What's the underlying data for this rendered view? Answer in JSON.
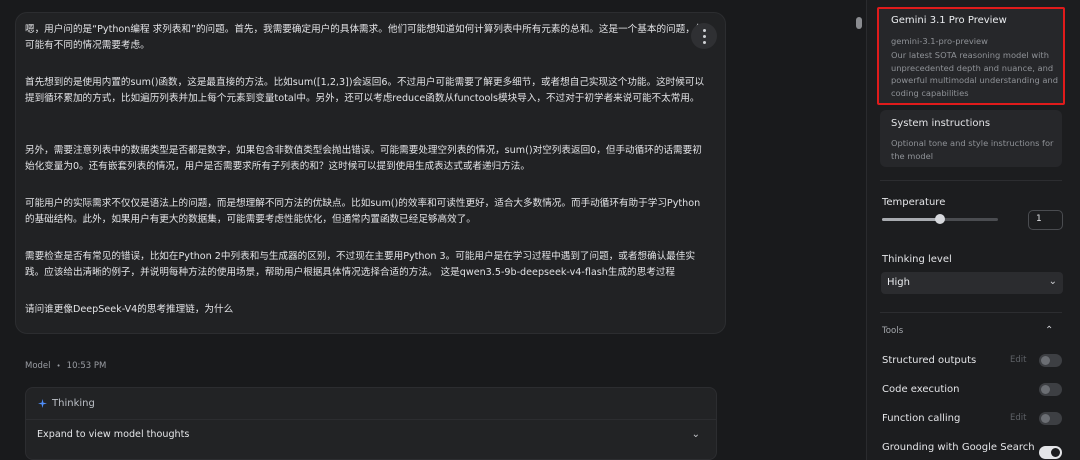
{
  "chat": {
    "paragraphs": [
      "嗯，用户问的是“Python编程 求列表和”的问题。首先，我需要确定用户的具体需求。他们可能想知道如何计算列表中所有元素的总和。这是一个基本的问题，但可能有不同的情况需要考虑。",
      "首先想到的是使用内置的sum()函数，这是最直接的方法。比如sum([1,2,3])会返回6。不过用户可能需要了解更多细节，或者想自己实现这个功能。这时候可以提到循环累加的方式，比如遍历列表并加上每个元素到变量total中。另外，还可以考虑reduce函数从functools模块导入，不过对于初学者来说可能不太常用。",
      "另外，需要注意列表中的数据类型是否都是数字，如果包含非数值类型会抛出错误。可能需要处理空列表的情况，sum()对空列表返回0，但手动循环的话需要初始化变量为0。还有嵌套列表的情况，用户是否需要求所有子列表的和？这时候可以提到使用生成表达式或者递归方法。",
      "可能用户的实际需求不仅仅是语法上的问题，而是想理解不同方法的优缺点。比如sum()的效率和可读性更好，适合大多数情况。而手动循环有助于学习Python的基础结构。此外，如果用户有更大的数据集，可能需要考虑性能优化，但通常内置函数已经足够高效了。",
      "需要检查是否有常见的错误，比如在Python 2中列表和与生成器的区别，不过现在主要用Python 3。可能用户是在学习过程中遇到了问题，或者想确认最佳实践。应该给出清晰的例子，并说明每种方法的使用场景，帮助用户根据具体情况选择合适的方法。 这是qwen3.5-9b-deepseek-v4-flash生成的思考过程",
      "请问谁更像DeepSeek-V4的思考推理链，为什么"
    ],
    "model_label": "Model",
    "timestamp": "10:53 PM",
    "thinking": {
      "label": "Thinking",
      "expand_label": "Expand to view model thoughts"
    }
  },
  "panel": {
    "model": {
      "title": "Gemini 3.1 Pro Preview",
      "id": "gemini-3.1-pro-preview",
      "description": "Our latest SOTA reasoning model with unprecedented depth and nuance, and powerful multimodal understanding and coding capabilities"
    },
    "system": {
      "title": "System instructions",
      "description": "Optional tone and style instructions for the model"
    },
    "temperature": {
      "label": "Temperature",
      "value": "1",
      "fraction": 0.5
    },
    "thinking_level": {
      "label": "Thinking level",
      "value": "High"
    },
    "tools": {
      "label": "Tools",
      "items": [
        {
          "name": "Structured outputs",
          "edit": "Edit",
          "on": false
        },
        {
          "name": "Code execution",
          "edit": "",
          "on": false
        },
        {
          "name": "Function calling",
          "edit": "Edit",
          "on": false
        },
        {
          "name": "Grounding with Google Search",
          "edit": "",
          "on": true
        }
      ]
    }
  },
  "colors": {
    "highlight_border": "#e01b1b",
    "thinking_icon": "#4f8df7"
  }
}
